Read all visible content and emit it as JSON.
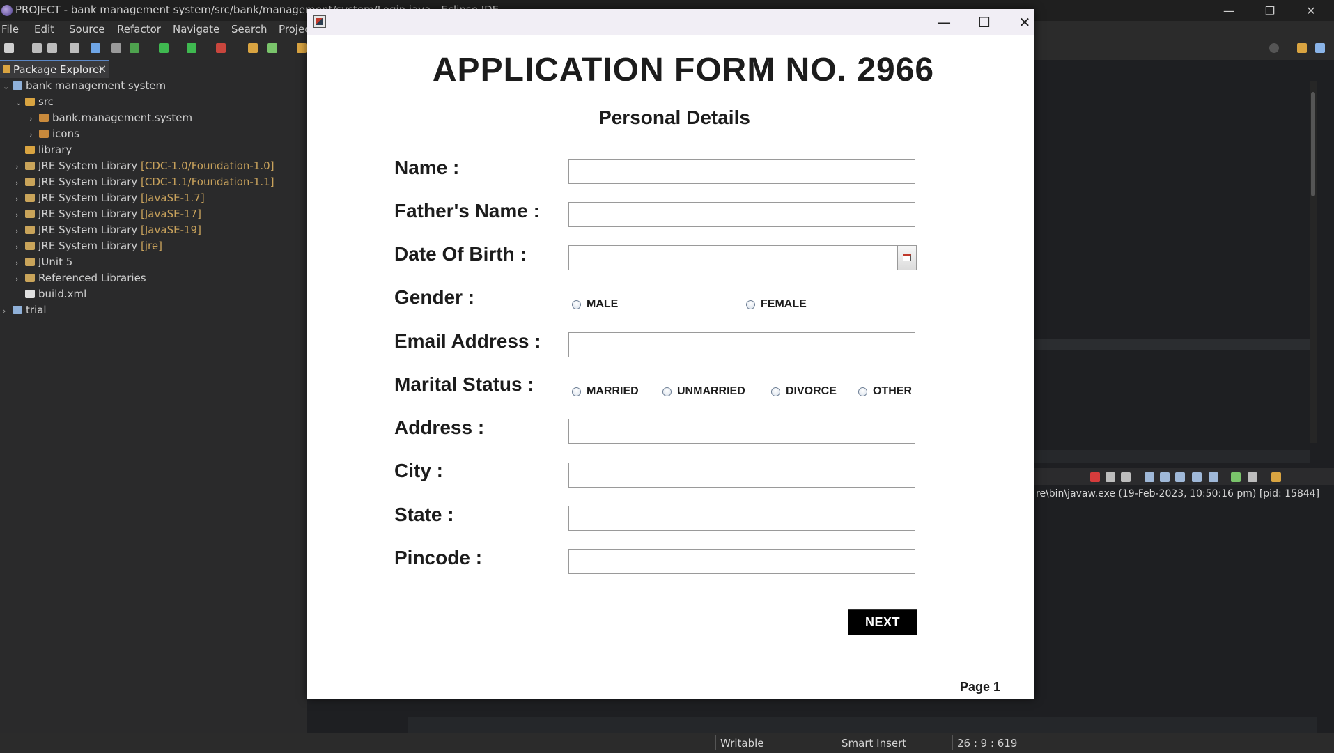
{
  "ide": {
    "window_title": "PROJECT - bank management system/src/bank/management/system/Login.java - Eclipse IDE",
    "menu": [
      "File",
      "Edit",
      "Source",
      "Refactor",
      "Navigate",
      "Search",
      "Project"
    ],
    "package_explorer_tab": "Package Explorer",
    "tree": [
      {
        "label": "bank management system",
        "qualifier": ""
      },
      {
        "label": "src",
        "qualifier": ""
      },
      {
        "label": "bank.management.system",
        "qualifier": ""
      },
      {
        "label": "icons",
        "qualifier": ""
      },
      {
        "label": "library",
        "qualifier": ""
      },
      {
        "label": "JRE System Library",
        "qualifier": "[CDC-1.0/Foundation-1.0]"
      },
      {
        "label": "JRE System Library",
        "qualifier": "[CDC-1.1/Foundation-1.1]"
      },
      {
        "label": "JRE System Library",
        "qualifier": "[JavaSE-1.7]"
      },
      {
        "label": "JRE System Library",
        "qualifier": "[JavaSE-17]"
      },
      {
        "label": "JRE System Library",
        "qualifier": "[JavaSE-19]"
      },
      {
        "label": "JRE System Library",
        "qualifier": "[jre]"
      },
      {
        "label": "JUnit 5",
        "qualifier": ""
      },
      {
        "label": "Referenced Libraries",
        "qualifier": ""
      },
      {
        "label": "build.xml",
        "qualifier": ""
      },
      {
        "label": "trial",
        "qualifier": ""
      }
    ],
    "console_path": "re\\bin\\javaw.exe  (19-Feb-2023, 10:50:16 pm) [pid: 15844]",
    "status": {
      "writable": "Writable",
      "insert_mode": "Smart Insert",
      "position": "26 : 9 : 619"
    }
  },
  "dialog": {
    "form_title": "APPLICATION FORM NO. 2966",
    "section_title": "Personal Details",
    "labels": {
      "name": "Name :",
      "father_name": "Father's Name :",
      "dob": "Date Of Birth :",
      "gender": "Gender :",
      "email": "Email Address :",
      "marital": "Marital Status :",
      "address": "Address :",
      "city": "City :",
      "state": "State :",
      "pincode": "Pincode :"
    },
    "values": {
      "name": "",
      "father_name": "",
      "dob": "",
      "email": "",
      "address": "",
      "city": "",
      "state": "",
      "pincode": ""
    },
    "gender_options": [
      "MALE",
      "FEMALE"
    ],
    "marital_options": [
      "MARRIED",
      "UNMARRIED",
      "DIVORCE",
      "OTHER"
    ],
    "next_label": "NEXT",
    "page_label": "Page 1"
  }
}
